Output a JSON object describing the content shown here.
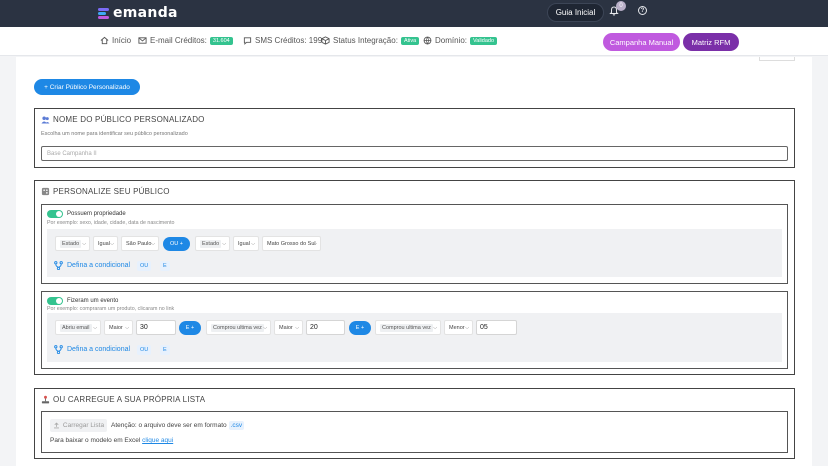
{
  "brand": {
    "name": "emanda",
    "colors": {
      "topbar": "#2b3342",
      "accent": "#1e88e5",
      "green": "#34c38f",
      "purple_light": "#c05adf",
      "purple_dark": "#7a2fa8"
    }
  },
  "topbar": {
    "guide_label": "Guia Inicial",
    "notifications_count": "0",
    "help_icon": "help-circle-icon"
  },
  "status": {
    "inicio": "Início",
    "email_label": "E-mail Créditos:",
    "email_badge": "31.604",
    "sms_label": "SMS Créditos: 199",
    "integration_label": "Status Integração:",
    "integration_badge": "Ativa",
    "domain_label": "Domínio:",
    "domain_badge": "Validado"
  },
  "actions": {
    "campaign_manual": "Campanha Manual",
    "matrix_rfm": "Matriz RFM",
    "create_public": "+ Criar Público Personalizado"
  },
  "name_section": {
    "title": "NOME DO PÚBLICO PERSONALIZADO",
    "subtitle": "Escolha um nome para identificar seu público personalizado",
    "placeholder": "Base Campanha II"
  },
  "personalize": {
    "title": "PERSONALIZE SEU PÚBLICO",
    "block1": {
      "title": "Possuem propriedade",
      "subtitle": "Por exemplo: sexo, idade, cidade, data de nascimento",
      "f1": "Estado",
      "f2": "Igual",
      "f3": "São Paulo",
      "join": "OU +",
      "f4": "Estado",
      "f5": "Igual",
      "f6": "Mato Grosso do Sul"
    },
    "block2": {
      "title": "Fizeram um evento",
      "subtitle": "Por exemplo: compraram um produto, clicaram no link",
      "f1": "Abriu email",
      "f2": "Maior",
      "v1": "30",
      "join1": "E +",
      "f3": "Comprou ultima vez",
      "f4": "Maior",
      "v2": "20",
      "join2": "E +",
      "f5": "Comprou ultima vez",
      "f6": "Menor",
      "v3": "05"
    },
    "condition_label": "Defina a condicional",
    "or_label": "OU",
    "and_label": "E"
  },
  "upload": {
    "title": "OU CARREGUE A SUA PRÓPRIA LISTA",
    "button": "Carregar Lista",
    "note": "Atenção: o arquivo deve ser em formato",
    "ext": ".csv",
    "download_text": "Para baixar o modelo em Excel",
    "download_link": "clique aqui"
  }
}
